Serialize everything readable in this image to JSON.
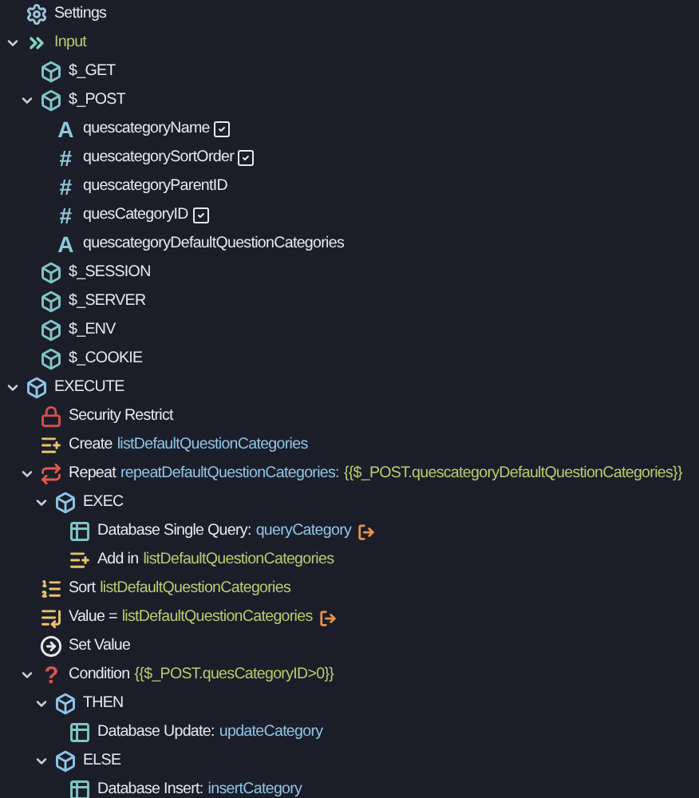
{
  "tree": [
    {
      "kind": "gear",
      "label": "Settings"
    },
    {
      "kind": "steps",
      "label": "Input",
      "expanded": true,
      "children": [
        {
          "kind": "cube",
          "label": "$_GET"
        },
        {
          "kind": "cube",
          "label": "$_POST",
          "expanded": true,
          "children": [
            {
              "kind": "string",
              "glyph": "A",
              "label": "quescategoryName",
              "checked": true
            },
            {
              "kind": "number",
              "glyph": "#",
              "label": "quescategorySortOrder",
              "checked": true
            },
            {
              "kind": "number",
              "glyph": "#",
              "label": "quescategoryParentID",
              "checked": false
            },
            {
              "kind": "number",
              "glyph": "#",
              "label": "quesCategoryID",
              "checked": true
            },
            {
              "kind": "string",
              "glyph": "A",
              "label": "quescategoryDefaultQuestionCategories",
              "checked": false
            }
          ]
        },
        {
          "kind": "cube",
          "label": "$_SESSION"
        },
        {
          "kind": "cube",
          "label": "$_SERVER"
        },
        {
          "kind": "cube",
          "label": "$_ENV"
        },
        {
          "kind": "cube",
          "label": "$_COOKIE"
        }
      ]
    },
    {
      "kind": "exec",
      "label": "EXECUTE",
      "expanded": true,
      "children": [
        {
          "kind": "lock",
          "label": "Security Restrict"
        },
        {
          "kind": "list-new",
          "label": "Create",
          "ref": "listDefaultQuestionCategories"
        },
        {
          "kind": "repeat",
          "label": "Repeat",
          "ref": "repeatDefaultQuestionCategories:",
          "binding": "{{$_POST.quescategoryDefaultQuestionCategories}}",
          "expanded": true,
          "children": [
            {
              "kind": "exec",
              "label": "EXEC",
              "expanded": true,
              "children": [
                {
                  "kind": "table",
                  "label": "Database Single Query:",
                  "ref": "queryCategory",
                  "output": true
                },
                {
                  "kind": "list-add",
                  "label": "Add  in",
                  "binding": "listDefaultQuestionCategories"
                }
              ]
            }
          ]
        },
        {
          "kind": "list-sort",
          "label": "Sort",
          "binding": "listDefaultQuestionCategories"
        },
        {
          "kind": "list-value",
          "label": "Value  =",
          "binding": "listDefaultQuestionCategories",
          "output": true
        },
        {
          "kind": "set-value",
          "label": "Set Value"
        },
        {
          "kind": "condition",
          "glyph": "?",
          "label": "Condition",
          "binding": "{{$_POST.quesCategoryID>0}}",
          "expanded": true,
          "children": [
            {
              "kind": "exec",
              "label": "THEN",
              "expanded": true,
              "children": [
                {
                  "kind": "table",
                  "label": "Database Update:",
                  "ref": "updateCategory"
                }
              ]
            },
            {
              "kind": "exec",
              "label": "ELSE",
              "expanded": true,
              "children": [
                {
                  "kind": "table",
                  "label": "Database Insert:",
                  "ref": "insertCategory"
                }
              ]
            }
          ]
        }
      ]
    }
  ]
}
